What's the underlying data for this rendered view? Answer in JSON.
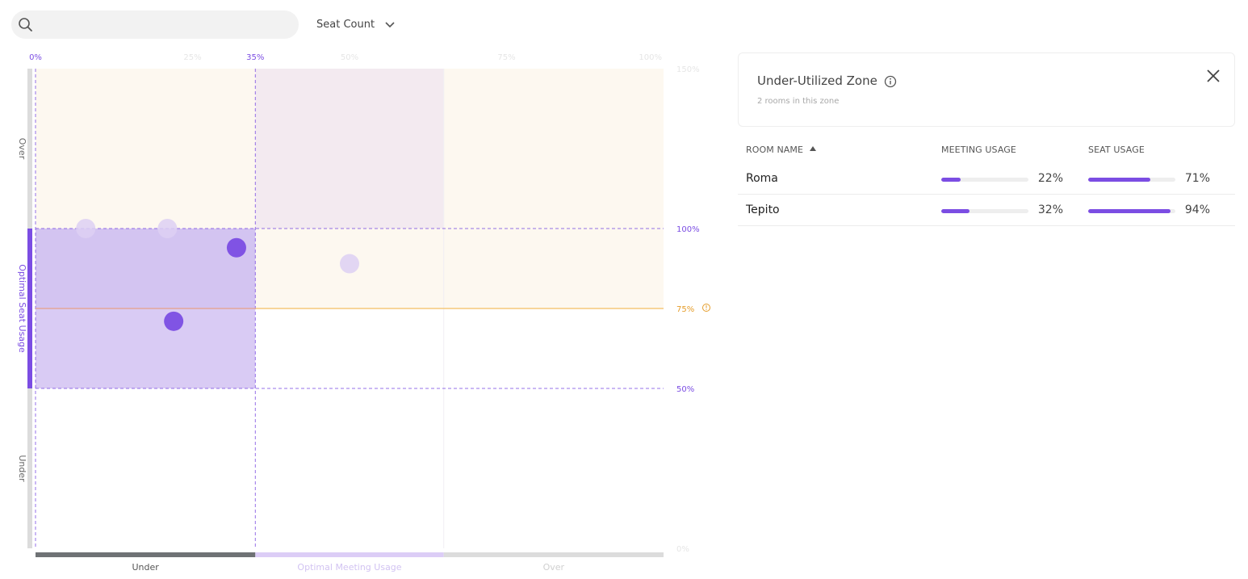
{
  "search": {
    "placeholder": "",
    "icon": "search-icon"
  },
  "metric_select": {
    "selected": "Seat Count",
    "icon": "chevron-down-icon"
  },
  "chart_data": {
    "type": "scatter",
    "x_axis_ticks": [
      "0%",
      "25%",
      "35%",
      "50%",
      "75%",
      "100%"
    ],
    "y_axis_ticks": [
      "150%",
      "100%",
      "75%",
      "50%",
      "0%"
    ],
    "y_bands": [
      "Over",
      "Optimal Seat Usage",
      "Under"
    ],
    "x_bands": [
      "Under",
      "Optimal Meeting Usage",
      "Over"
    ],
    "threshold_label": "75%",
    "xlim": [
      0,
      100
    ],
    "ylim": [
      0,
      150
    ],
    "highlight_zone": {
      "x": [
        0,
        35
      ],
      "y": [
        50,
        100
      ]
    },
    "optimal_meeting_x": [
      35,
      65
    ],
    "optimal_seat_y": [
      50,
      100
    ],
    "threshold_y": 75,
    "points": [
      {
        "x": 8,
        "y": 100,
        "highlighted": false
      },
      {
        "x": 21,
        "y": 100,
        "highlighted": false
      },
      {
        "x": 32,
        "y": 94,
        "highlighted": true
      },
      {
        "x": 22,
        "y": 71,
        "highlighted": true
      },
      {
        "x": 50,
        "y": 89,
        "highlighted": false
      }
    ],
    "colors": {
      "accent": "#7b4de3",
      "threshold": "#f5c87a",
      "threshold_text": "#e59d2a",
      "over_zone": "#fdf8f0",
      "over_optimal_zone": "#f3eaf0",
      "highlight_zone": "#d9cbf4"
    }
  },
  "panel": {
    "title": "Under-Utilized Zone",
    "subtitle": "2 rooms in this zone",
    "info_icon": "info-icon",
    "close_icon": "close-icon"
  },
  "table": {
    "headers": {
      "room": "Room Name",
      "meeting": "Meeting Usage",
      "seat": "Seat Usage"
    },
    "rows": [
      {
        "name": "Roma",
        "meeting_pct": "22%",
        "meeting_value": 22,
        "seat_pct": "71%",
        "seat_value": 71
      },
      {
        "name": "Tepito",
        "meeting_pct": "32%",
        "meeting_value": 32,
        "seat_pct": "94%",
        "seat_value": 94
      }
    ]
  }
}
